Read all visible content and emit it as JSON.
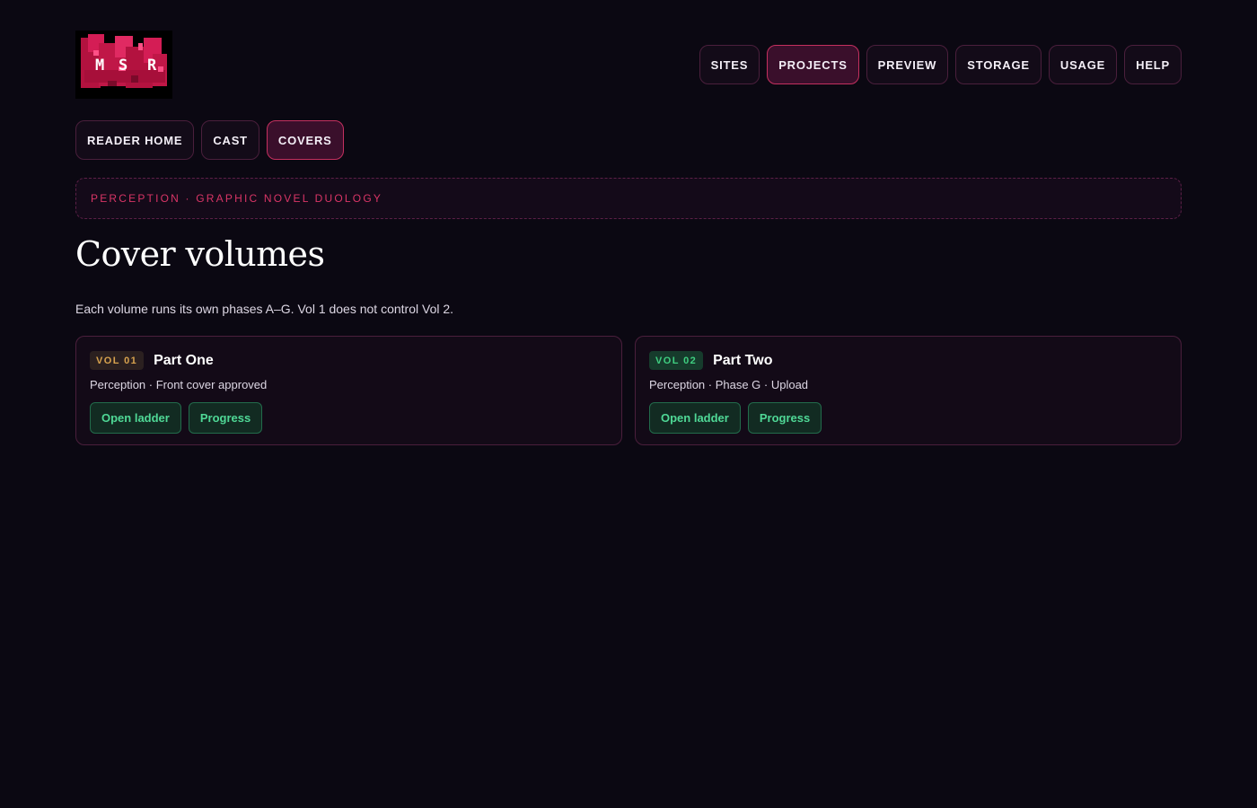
{
  "logo": {
    "text": "MSR"
  },
  "main_nav": [
    {
      "label": "SITES",
      "active": false
    },
    {
      "label": "PROJECTS",
      "active": true
    },
    {
      "label": "PREVIEW",
      "active": false
    },
    {
      "label": "STORAGE",
      "active": false
    },
    {
      "label": "USAGE",
      "active": false
    },
    {
      "label": "HELP",
      "active": false
    }
  ],
  "sub_nav": [
    {
      "label": "READER HOME",
      "active": false
    },
    {
      "label": "CAST",
      "active": false
    },
    {
      "label": "COVERS",
      "active": true
    }
  ],
  "eyebrow": "PERCEPTION · GRAPHIC NOVEL DUOLOGY",
  "page_title": "Cover volumes",
  "intro": "Each volume runs its own phases A–G. Vol 1 does not control Vol 2.",
  "volumes": [
    {
      "badge": "VOL 01",
      "badge_color": "#d7a24e",
      "title": "Part One",
      "meta": "Perception · Front cover approved",
      "actions": [
        "Open ladder",
        "Progress"
      ]
    },
    {
      "badge": "VOL 02",
      "badge_color": "#3fce80",
      "title": "Part Two",
      "meta": "Perception · Phase G · Upload",
      "actions": [
        "Open ladder",
        "Progress"
      ]
    }
  ],
  "colors": {
    "background": "#0b0812",
    "accent": "#c4305f",
    "action_green": "#4fd896"
  }
}
